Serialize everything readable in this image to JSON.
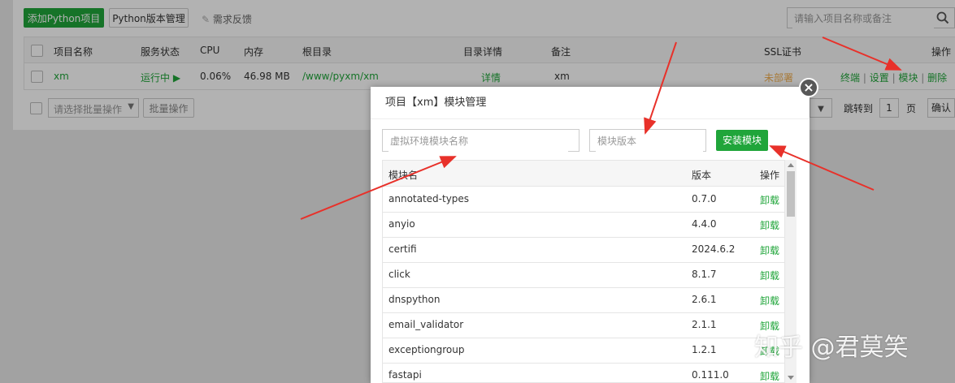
{
  "toolbar": {
    "add_python_project": "添加Python项目",
    "python_version_mgmt": "Python版本管理",
    "feedback": "需求反馈",
    "search_placeholder": "请输入项目名称或备注"
  },
  "table": {
    "headers": [
      "项目名称",
      "服务状态",
      "CPU",
      "内存",
      "根目录",
      "目录详情",
      "备注",
      "SSL证书",
      "操作"
    ],
    "row": {
      "name": "xm",
      "status": "运行中",
      "cpu": "0.06%",
      "memory": "46.98 MB",
      "root": "/www/pyxm/xm",
      "detail": "详情",
      "remark": "xm",
      "ssl": "未部署",
      "actions": [
        "终端",
        "设置",
        "模块",
        "删除"
      ]
    }
  },
  "batch": {
    "select_placeholder": "请选择批量操作",
    "batch_button": "批量操作",
    "jump_to": "跳转到",
    "page_value": "1",
    "page_unit": "页",
    "confirm": "确认"
  },
  "modal": {
    "title": "项目【xm】模块管理",
    "name_placeholder": "虚拟环境模块名称",
    "version_placeholder": "模块版本",
    "install_button": "安装模块",
    "headers": [
      "模块名",
      "版本",
      "操作"
    ],
    "rows": [
      {
        "name": "annotated-types",
        "version": "0.7.0",
        "action": "卸载"
      },
      {
        "name": "anyio",
        "version": "4.4.0",
        "action": "卸载"
      },
      {
        "name": "certifi",
        "version": "2024.6.2",
        "action": "卸载"
      },
      {
        "name": "click",
        "version": "8.1.7",
        "action": "卸载"
      },
      {
        "name": "dnspython",
        "version": "2.6.1",
        "action": "卸载"
      },
      {
        "name": "email_validator",
        "version": "2.1.1",
        "action": "卸载"
      },
      {
        "name": "exceptiongroup",
        "version": "1.2.1",
        "action": "卸载"
      },
      {
        "name": "fastapi",
        "version": "0.111.0",
        "action": "卸载"
      }
    ]
  },
  "watermark": "知乎 @君莫笑",
  "colors": {
    "accent": "#20a53a",
    "warning": "#f0ad4e",
    "annotation": "#e8312a"
  }
}
